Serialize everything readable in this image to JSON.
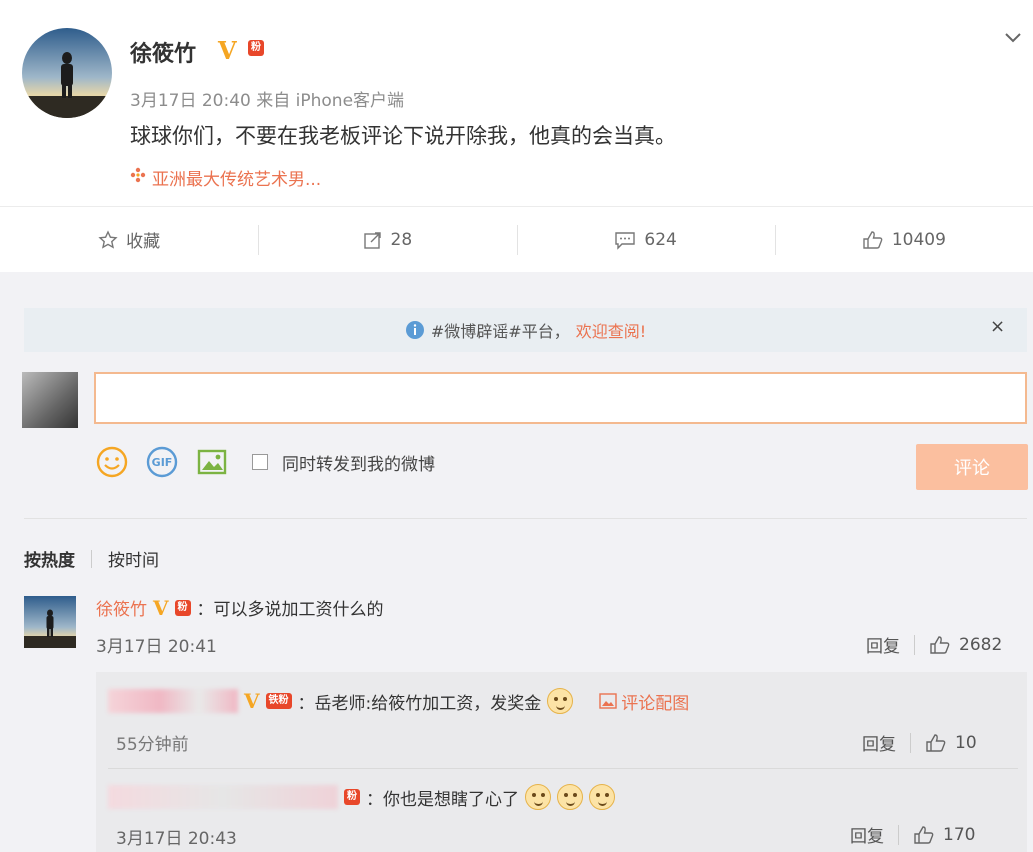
{
  "post": {
    "author": "徐筱竹",
    "vip_mark": "V",
    "badge": "粉",
    "time": "3月17日 20:40 来自 iPhone客户端",
    "text": "球球你们，不要在我老板评论下说开除我，他真的会当真。",
    "topic": "亚洲最大传统艺术男..."
  },
  "actions": {
    "favorite": "收藏",
    "repost_count": "28",
    "comment_count": "624",
    "like_count": "10409"
  },
  "notice": {
    "prefix": "#微博辟谣#平台，",
    "highlight": "欢迎查阅!",
    "close": "×"
  },
  "composer": {
    "input_value": "",
    "repost_label": "同时转发到我的微博",
    "submit_label": "评论"
  },
  "sort": {
    "hot": "按热度",
    "time": "按时间"
  },
  "comments": [
    {
      "author": "徐筱竹",
      "vip_mark": "V",
      "badge": "粉",
      "text": "：可以多说加工资什么的",
      "time": "3月17日 20:41",
      "reply_label": "回复",
      "likes": "2682",
      "replies": [
        {
          "vip_mark": "V",
          "badge": "铁粉",
          "text": "：岳老师:给筱竹加工资，发奖金",
          "pic_label": "评论配图",
          "time": "55分钟前",
          "reply_label": "回复",
          "likes": "10"
        },
        {
          "badge": "粉",
          "text": "：你也是想瞎了心了",
          "time": "3月17日 20:43",
          "reply_label": "回复",
          "likes": "170"
        }
      ]
    }
  ],
  "colors": {
    "accent": "#eb7350",
    "vip": "#f5a623",
    "submit_disabled": "#fbbf9f"
  }
}
